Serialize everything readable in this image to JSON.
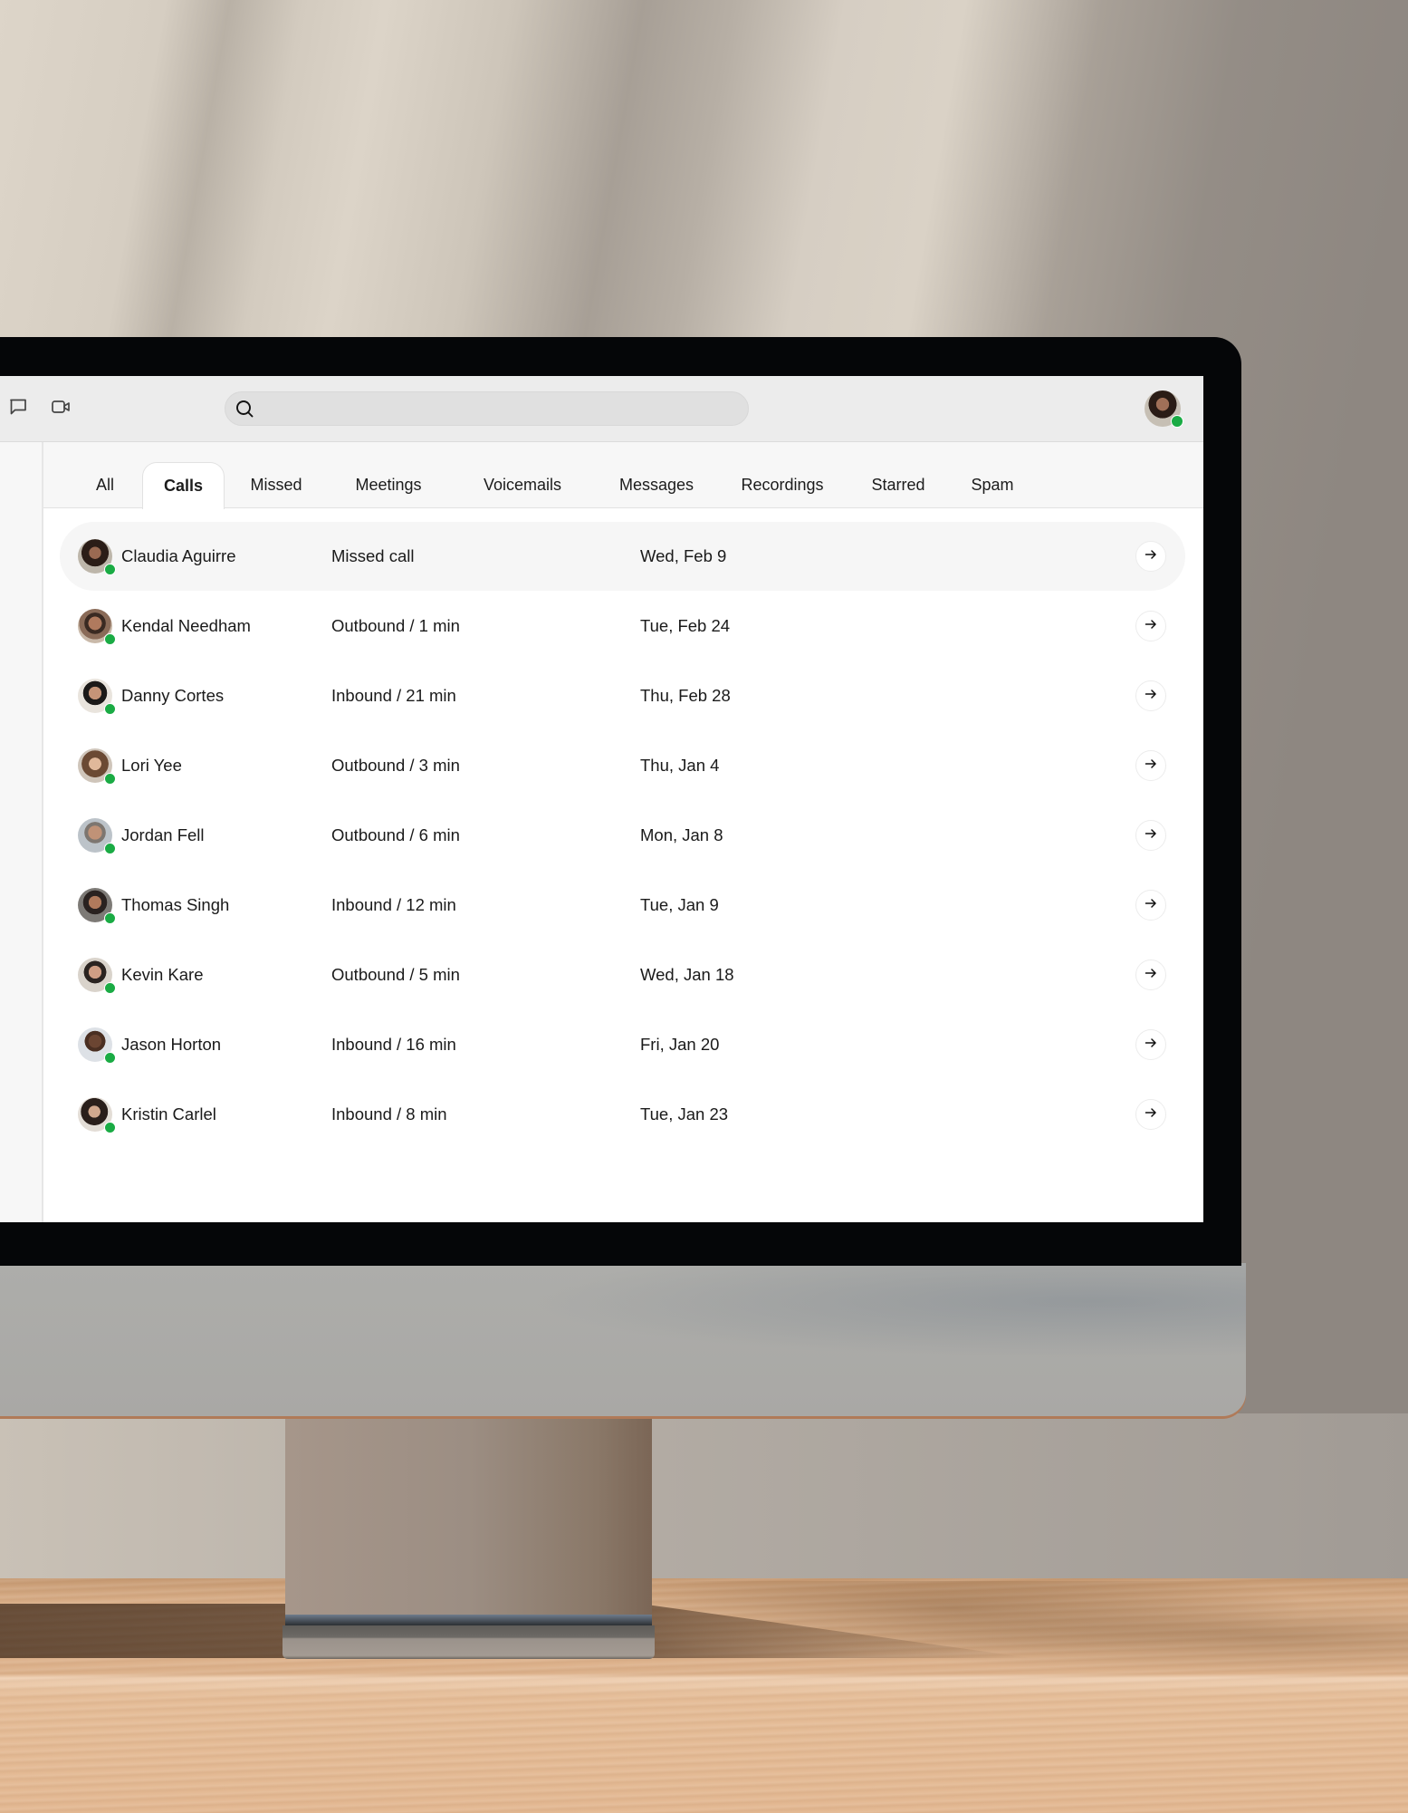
{
  "app": {
    "toolbar": {
      "icons": [
        "chat-icon",
        "video-camera-icon"
      ],
      "search": {
        "value": "",
        "placeholder": ""
      },
      "user_status": "online"
    },
    "tabs": [
      {
        "label": "All",
        "active": false
      },
      {
        "label": "Calls",
        "active": true
      },
      {
        "label": "Missed",
        "active": false
      },
      {
        "label": "Meetings",
        "active": false
      },
      {
        "label": "Voicemails",
        "active": false
      },
      {
        "label": "Messages",
        "active": false
      },
      {
        "label": "Recordings",
        "active": false
      },
      {
        "label": "Starred",
        "active": false
      },
      {
        "label": "Spam",
        "active": false
      }
    ],
    "calls": [
      {
        "name": "Claudia Aguirre",
        "detail": "Missed call",
        "date": "Wed, Feb 9",
        "status": "online",
        "highlighted": true
      },
      {
        "name": "Kendal Needham",
        "detail": "Outbound / 1 min",
        "date": "Tue, Feb 24",
        "status": "online",
        "highlighted": false
      },
      {
        "name": "Danny Cortes",
        "detail": "Inbound / 21 min",
        "date": "Thu, Feb 28",
        "status": "online",
        "highlighted": false
      },
      {
        "name": "Lori Yee",
        "detail": "Outbound / 3 min",
        "date": "Thu, Jan 4",
        "status": "online",
        "highlighted": false
      },
      {
        "name": "Jordan Fell",
        "detail": "Outbound / 6 min",
        "date": "Mon, Jan 8",
        "status": "online",
        "highlighted": false
      },
      {
        "name": "Thomas Singh",
        "detail": "Inbound / 12 min",
        "date": "Tue, Jan 9",
        "status": "online",
        "highlighted": false
      },
      {
        "name": "Kevin Kare",
        "detail": "Outbound / 5 min",
        "date": "Wed, Jan 18",
        "status": "online",
        "highlighted": false
      },
      {
        "name": "Jason Horton",
        "detail": "Inbound / 16 min",
        "date": "Fri, Jan 20",
        "status": "online",
        "highlighted": false
      },
      {
        "name": "Kristin Carlel",
        "detail": "Inbound / 8 min",
        "date": "Tue, Jan 23",
        "status": "online",
        "highlighted": false
      }
    ],
    "colors": {
      "online": "#1aab44",
      "accent_text": "#1a1a1a",
      "toolbar_bg": "#ececec"
    }
  }
}
